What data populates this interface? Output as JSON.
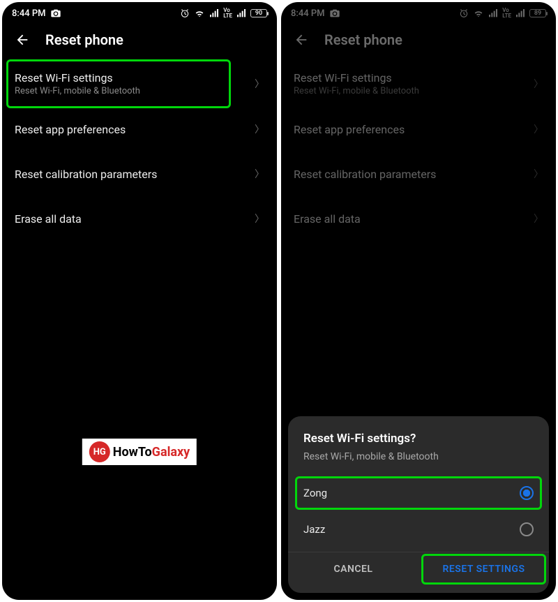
{
  "status": {
    "time": "8:44 PM",
    "battery_left": "90",
    "battery_right": "89"
  },
  "header": {
    "title": "Reset phone"
  },
  "items": [
    {
      "title": "Reset Wi-Fi settings",
      "sub": "Reset Wi-Fi, mobile & Bluetooth"
    },
    {
      "title": "Reset app preferences",
      "sub": ""
    },
    {
      "title": "Reset calibration parameters",
      "sub": ""
    },
    {
      "title": "Erase all data",
      "sub": ""
    }
  ],
  "watermark": {
    "logo": "HG",
    "howto": "HowTo",
    "galaxy": "Galaxy"
  },
  "dialog": {
    "title": "Reset Wi-Fi settings?",
    "sub": "Reset Wi-Fi, mobile & Bluetooth",
    "options": [
      {
        "label": "Zong",
        "selected": true
      },
      {
        "label": "Jazz",
        "selected": false
      }
    ],
    "cancel": "CANCEL",
    "confirm": "RESET SETTINGS"
  }
}
